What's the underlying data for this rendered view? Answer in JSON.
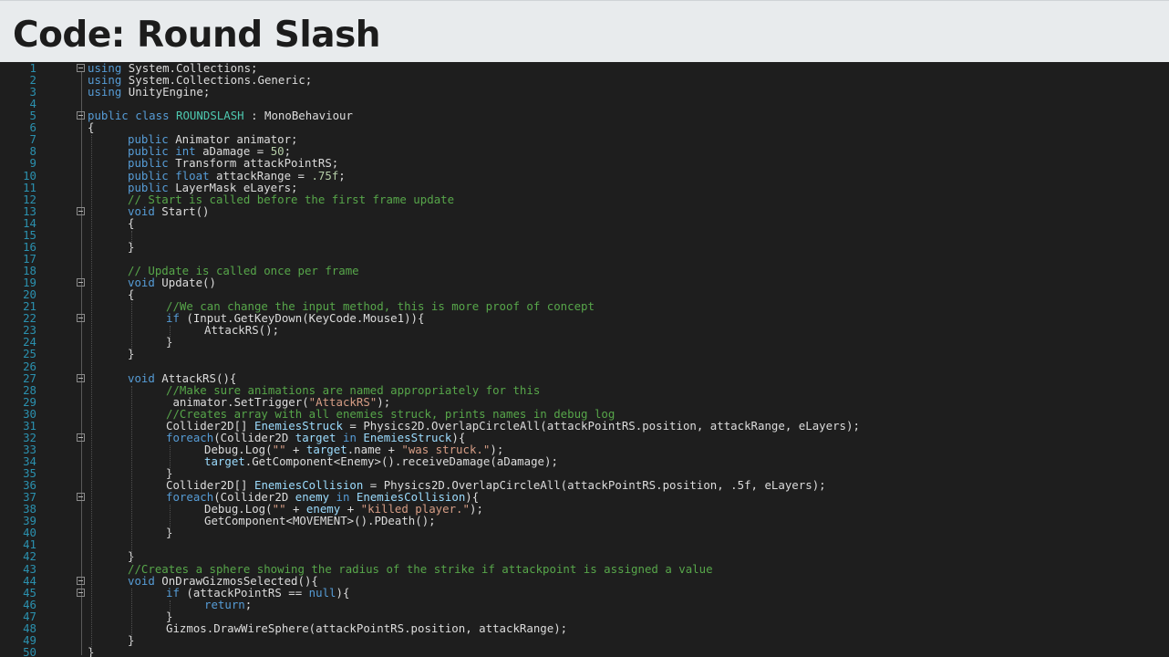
{
  "slide": {
    "title": "Code: Round Slash"
  },
  "code": {
    "lines": [
      {
        "n": "1",
        "indent": 1,
        "fold": true,
        "tokens": [
          {
            "t": "using",
            "c": "kw"
          },
          {
            "t": " System.Collections;",
            "c": "plain"
          }
        ]
      },
      {
        "n": "2",
        "indent": 1,
        "tokens": [
          {
            "t": "using",
            "c": "kw"
          },
          {
            "t": " System.Collections.Generic;",
            "c": "plain"
          }
        ]
      },
      {
        "n": "3",
        "indent": 1,
        "tokens": [
          {
            "t": "using",
            "c": "kw"
          },
          {
            "t": " UnityEngine;",
            "c": "plain"
          }
        ]
      },
      {
        "n": "4",
        "indent": 1,
        "tokens": []
      },
      {
        "n": "5",
        "indent": 0,
        "fold": true,
        "tokens": [
          {
            "t": "public",
            "c": "kw"
          },
          {
            "t": " ",
            "c": "plain"
          },
          {
            "t": "class",
            "c": "kw"
          },
          {
            "t": " ",
            "c": "plain"
          },
          {
            "t": "ROUNDSLASH",
            "c": "type"
          },
          {
            "t": " : MonoBehaviour",
            "c": "plain"
          }
        ]
      },
      {
        "n": "6",
        "indent": 1,
        "tokens": [
          {
            "t": "{",
            "c": "plain"
          }
        ]
      },
      {
        "n": "7",
        "indent": 2,
        "tokens": [
          {
            "t": "public",
            "c": "kw"
          },
          {
            "t": " Animator animator;",
            "c": "plain"
          }
        ]
      },
      {
        "n": "8",
        "indent": 2,
        "tokens": [
          {
            "t": "public",
            "c": "kw"
          },
          {
            "t": " ",
            "c": "plain"
          },
          {
            "t": "int",
            "c": "kw"
          },
          {
            "t": " aDamage = ",
            "c": "plain"
          },
          {
            "t": "50",
            "c": "num"
          },
          {
            "t": ";",
            "c": "plain"
          }
        ]
      },
      {
        "n": "9",
        "indent": 2,
        "tokens": [
          {
            "t": "public",
            "c": "kw"
          },
          {
            "t": " Transform attackPointRS;",
            "c": "plain"
          }
        ]
      },
      {
        "n": "10",
        "indent": 2,
        "tokens": [
          {
            "t": "public",
            "c": "kw"
          },
          {
            "t": " ",
            "c": "plain"
          },
          {
            "t": "float",
            "c": "kw"
          },
          {
            "t": " attackRange = ",
            "c": "plain"
          },
          {
            "t": ".75f",
            "c": "num"
          },
          {
            "t": ";",
            "c": "plain"
          }
        ]
      },
      {
        "n": "11",
        "indent": 2,
        "tokens": [
          {
            "t": "public",
            "c": "kw"
          },
          {
            "t": " LayerMask eLayers;",
            "c": "plain"
          }
        ]
      },
      {
        "n": "12",
        "indent": 2,
        "tokens": [
          {
            "t": "// Start is called before the first frame update",
            "c": "cmt"
          }
        ]
      },
      {
        "n": "13",
        "indent": 2,
        "fold": true,
        "tokens": [
          {
            "t": "void",
            "c": "kw"
          },
          {
            "t": " Start()",
            "c": "plain"
          }
        ]
      },
      {
        "n": "14",
        "indent": 2,
        "tokens": [
          {
            "t": "{",
            "c": "plain"
          }
        ]
      },
      {
        "n": "15",
        "indent": 2,
        "tokens": []
      },
      {
        "n": "16",
        "indent": 2,
        "tokens": [
          {
            "t": "}",
            "c": "plain"
          }
        ]
      },
      {
        "n": "17",
        "indent": 2,
        "tokens": []
      },
      {
        "n": "18",
        "indent": 2,
        "tokens": [
          {
            "t": "// Update is called once per frame",
            "c": "cmt"
          }
        ]
      },
      {
        "n": "19",
        "indent": 2,
        "fold": true,
        "tokens": [
          {
            "t": "void",
            "c": "kw"
          },
          {
            "t": " Update()",
            "c": "plain"
          }
        ]
      },
      {
        "n": "20",
        "indent": 2,
        "tokens": [
          {
            "t": "{",
            "c": "plain"
          }
        ]
      },
      {
        "n": "21",
        "indent": 3,
        "tokens": [
          {
            "t": "//We can change the input method, this is more proof of concept",
            "c": "cmt"
          }
        ]
      },
      {
        "n": "22",
        "indent": 3,
        "fold": true,
        "tokens": [
          {
            "t": "if",
            "c": "kw"
          },
          {
            "t": " (Input.GetKeyDown(KeyCode.Mouse1)){",
            "c": "plain"
          }
        ]
      },
      {
        "n": "23",
        "indent": 4,
        "tokens": [
          {
            "t": "AttackRS();",
            "c": "plain"
          }
        ]
      },
      {
        "n": "24",
        "indent": 3,
        "tokens": [
          {
            "t": "}",
            "c": "plain"
          }
        ]
      },
      {
        "n": "25",
        "indent": 2,
        "tokens": [
          {
            "t": "}",
            "c": "plain"
          }
        ]
      },
      {
        "n": "26",
        "indent": 2,
        "tokens": []
      },
      {
        "n": "27",
        "indent": 2,
        "fold": true,
        "tokens": [
          {
            "t": "void",
            "c": "kw"
          },
          {
            "t": " AttackRS(){",
            "c": "plain"
          }
        ]
      },
      {
        "n": "28",
        "indent": 3,
        "tokens": [
          {
            "t": "//Make sure animations are named appropriately for this",
            "c": "cmt"
          }
        ]
      },
      {
        "n": "29",
        "indent": 3,
        "tokens": [
          {
            "t": " animator.SetTrigger(",
            "c": "plain"
          },
          {
            "t": "\"AttackRS\"",
            "c": "str"
          },
          {
            "t": ");",
            "c": "plain"
          }
        ]
      },
      {
        "n": "30",
        "indent": 3,
        "tokens": [
          {
            "t": "//Creates array with all enemies struck, prints names in debug log",
            "c": "cmt"
          }
        ]
      },
      {
        "n": "31",
        "indent": 3,
        "tokens": [
          {
            "t": "Collider2D[] ",
            "c": "plain"
          },
          {
            "t": "EnemiesStruck",
            "c": "var"
          },
          {
            "t": " = Physics2D.OverlapCircleAll(attackPointRS.position, attackRange, eLayers);",
            "c": "plain"
          }
        ]
      },
      {
        "n": "32",
        "indent": 3,
        "fold": true,
        "tokens": [
          {
            "t": "foreach",
            "c": "kw"
          },
          {
            "t": "(Collider2D ",
            "c": "plain"
          },
          {
            "t": "target",
            "c": "var"
          },
          {
            "t": " ",
            "c": "plain"
          },
          {
            "t": "in",
            "c": "kw"
          },
          {
            "t": " ",
            "c": "plain"
          },
          {
            "t": "EnemiesStruck",
            "c": "var"
          },
          {
            "t": "){",
            "c": "plain"
          }
        ]
      },
      {
        "n": "33",
        "indent": 4,
        "tokens": [
          {
            "t": "Debug.Log(",
            "c": "plain"
          },
          {
            "t": "\"\"",
            "c": "str"
          },
          {
            "t": " + ",
            "c": "plain"
          },
          {
            "t": "target",
            "c": "var"
          },
          {
            "t": ".name + ",
            "c": "plain"
          },
          {
            "t": "\"was struck.\"",
            "c": "str"
          },
          {
            "t": ");",
            "c": "plain"
          }
        ]
      },
      {
        "n": "34",
        "indent": 4,
        "tokens": [
          {
            "t": "target",
            "c": "var"
          },
          {
            "t": ".GetComponent<Enemy>().receiveDamage(aDamage);",
            "c": "plain"
          }
        ]
      },
      {
        "n": "35",
        "indent": 3,
        "tokens": [
          {
            "t": "}",
            "c": "plain"
          }
        ]
      },
      {
        "n": "36",
        "indent": 3,
        "tokens": [
          {
            "t": "Collider2D[] ",
            "c": "plain"
          },
          {
            "t": "EnemiesCollision",
            "c": "var"
          },
          {
            "t": " = Physics2D.OverlapCircleAll(attackPointRS.position, .5f, eLayers);",
            "c": "plain"
          }
        ]
      },
      {
        "n": "37",
        "indent": 3,
        "fold": true,
        "tokens": [
          {
            "t": "foreach",
            "c": "kw"
          },
          {
            "t": "(Collider2D ",
            "c": "plain"
          },
          {
            "t": "enemy",
            "c": "var"
          },
          {
            "t": " ",
            "c": "plain"
          },
          {
            "t": "in",
            "c": "kw"
          },
          {
            "t": " ",
            "c": "plain"
          },
          {
            "t": "EnemiesCollision",
            "c": "var"
          },
          {
            "t": "){",
            "c": "plain"
          }
        ]
      },
      {
        "n": "38",
        "indent": 4,
        "tokens": [
          {
            "t": "Debug.Log(",
            "c": "plain"
          },
          {
            "t": "\"\"",
            "c": "str"
          },
          {
            "t": " + ",
            "c": "plain"
          },
          {
            "t": "enemy",
            "c": "var"
          },
          {
            "t": " + ",
            "c": "plain"
          },
          {
            "t": "\"killed player.\"",
            "c": "str"
          },
          {
            "t": ");",
            "c": "plain"
          }
        ]
      },
      {
        "n": "39",
        "indent": 4,
        "tokens": [
          {
            "t": "GetComponent<MOVEMENT>().PDeath();",
            "c": "plain"
          }
        ]
      },
      {
        "n": "40",
        "indent": 3,
        "tokens": [
          {
            "t": "}",
            "c": "plain"
          }
        ]
      },
      {
        "n": "41",
        "indent": 3,
        "tokens": []
      },
      {
        "n": "42",
        "indent": 2,
        "tokens": [
          {
            "t": "}",
            "c": "plain"
          }
        ]
      },
      {
        "n": "43",
        "indent": 2,
        "tokens": [
          {
            "t": "//Creates a sphere showing the radius of the strike if attackpoint is assigned a value",
            "c": "cmt"
          }
        ]
      },
      {
        "n": "44",
        "indent": 2,
        "fold": true,
        "tokens": [
          {
            "t": "void",
            "c": "kw"
          },
          {
            "t": " OnDrawGizmosSelected(){",
            "c": "plain"
          }
        ]
      },
      {
        "n": "45",
        "indent": 3,
        "fold": true,
        "tokens": [
          {
            "t": "if",
            "c": "kw"
          },
          {
            "t": " (attackPointRS == ",
            "c": "plain"
          },
          {
            "t": "null",
            "c": "kw"
          },
          {
            "t": "){",
            "c": "plain"
          }
        ]
      },
      {
        "n": "46",
        "indent": 4,
        "tokens": [
          {
            "t": "return",
            "c": "kw"
          },
          {
            "t": ";",
            "c": "plain"
          }
        ]
      },
      {
        "n": "47",
        "indent": 3,
        "tokens": [
          {
            "t": "}",
            "c": "plain"
          }
        ]
      },
      {
        "n": "48",
        "indent": 3,
        "tokens": [
          {
            "t": "Gizmos.DrawWireSphere(attackPointRS.position, attackRange);",
            "c": "plain"
          }
        ]
      },
      {
        "n": "49",
        "indent": 2,
        "tokens": [
          {
            "t": "}",
            "c": "plain"
          }
        ]
      },
      {
        "n": "50",
        "indent": 1,
        "tokens": [
          {
            "t": "}",
            "c": "plain"
          }
        ]
      }
    ]
  }
}
